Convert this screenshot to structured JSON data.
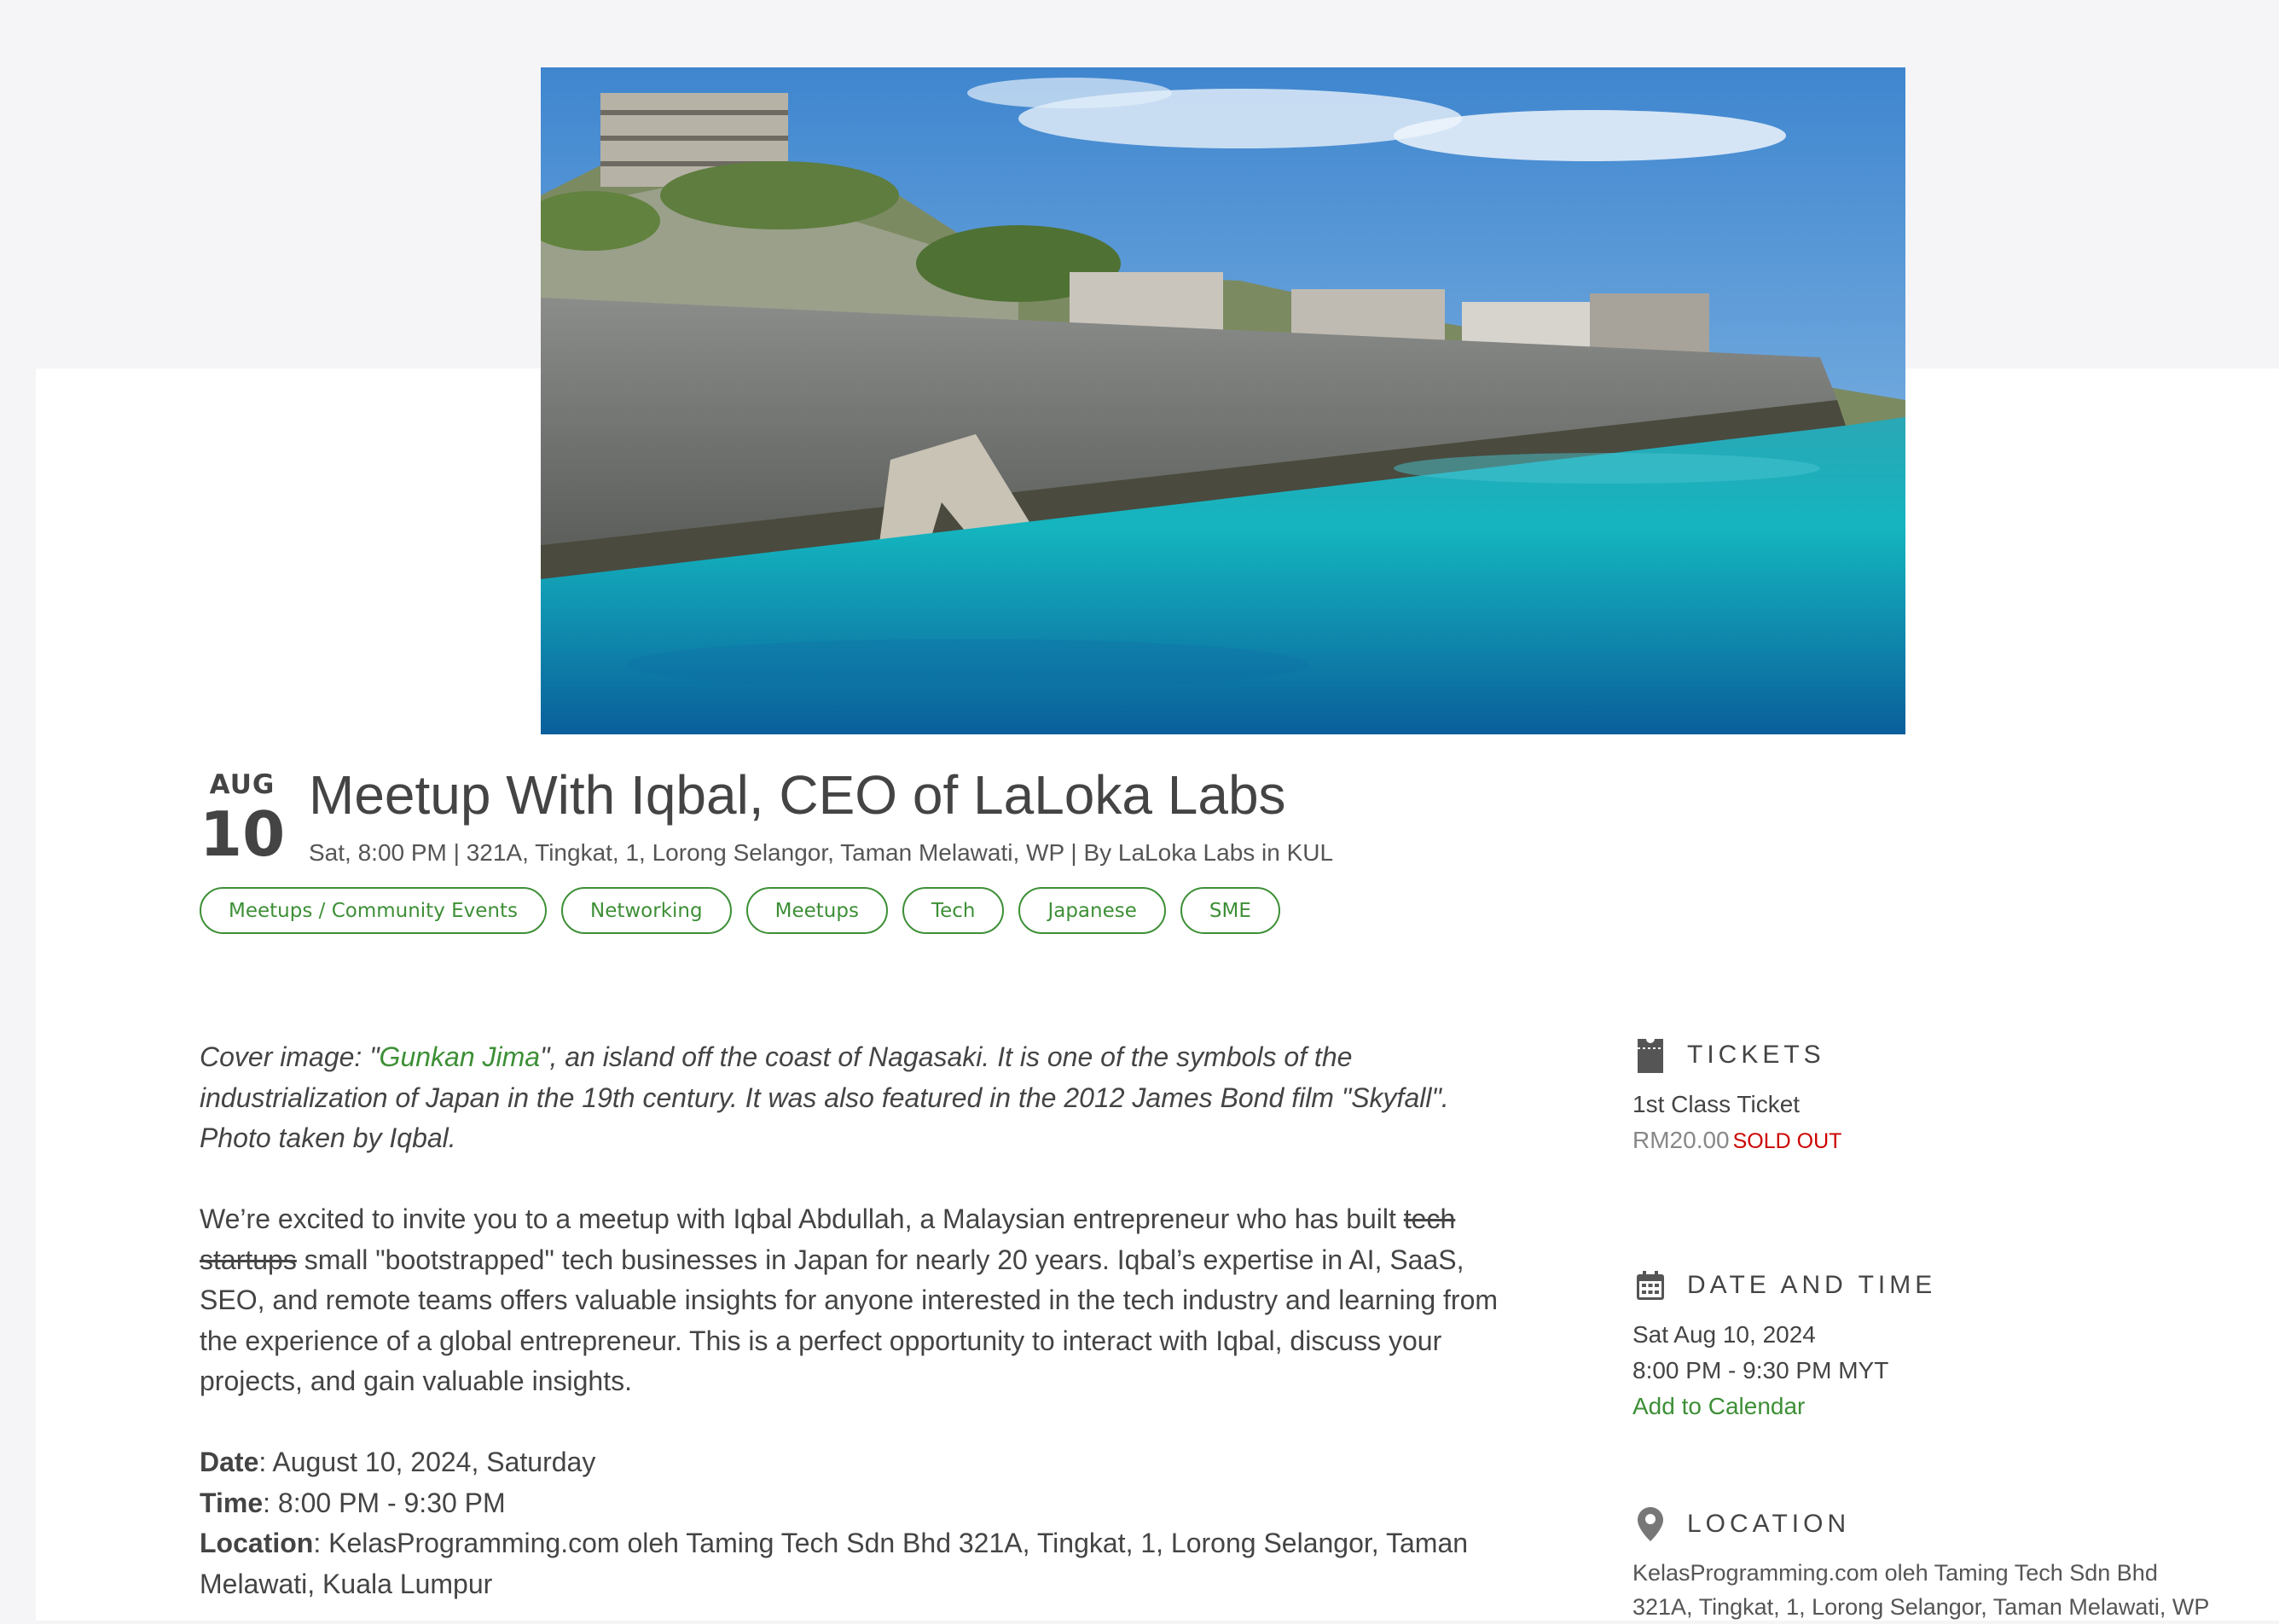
{
  "event": {
    "month": "AUG",
    "day": "10",
    "title": "Meetup With Iqbal, CEO of LaLoka Labs",
    "subline": "Sat, 8:00 PM | 321A, Tingkat, 1, Lorong Selangor, Taman Melawati, WP | By LaLoka Labs in KUL"
  },
  "tags": [
    "Meetups / Community Events",
    "Networking",
    "Meetups",
    "Tech",
    "Japanese",
    "SME"
  ],
  "description": {
    "cover_prefix": "Cover image: \"",
    "cover_link": "Gunkan Jima",
    "cover_suffix": "\", an island off the coast of Nagasaki. It is one of the symbols of the industrialization of Japan in the 19th century. It was also featured in the 2012 James Bond film \"Skyfall\". Photo taken by Iqbal.",
    "intro_before": "We’re excited to invite you to a meetup with Iqbal Abdullah, a Malaysian entrepreneur who has built ",
    "intro_strike": "tech startups",
    "intro_after": " small \"bootstrapped\" tech businesses in Japan for nearly 20 years. Iqbal’s expertise in AI, SaaS, SEO, and remote teams offers valuable insights for anyone interested in the tech industry and learning from the experience of a global entrepreneur. This is a perfect opportunity to interact with Iqbal, discuss your projects, and gain valuable insights.",
    "date_label": "Date",
    "date_value": ": August 10, 2024, Saturday",
    "time_label": "Time",
    "time_value": ": 8:00 PM - 9:30 PM",
    "location_label": "Location",
    "location_value": ": KelasProgramming.com oleh Taming Tech Sdn Bhd 321A, Tingkat, 1, Lorong Selangor, Taman Melawati, Kuala Lumpur"
  },
  "sidebar": {
    "tickets": {
      "heading": "TICKETS",
      "icon": "ticket-icon",
      "name": "1st Class Ticket",
      "price": "RM20.00",
      "status": "SOLD OUT"
    },
    "datetime": {
      "heading": "DATE AND TIME",
      "icon": "calendar-icon",
      "date": "Sat Aug 10, 2024",
      "time": "8:00 PM - 9:30 PM MYT",
      "add_calendar": "Add to Calendar"
    },
    "location": {
      "heading": "LOCATION",
      "icon": "map-pin-icon",
      "line1": "KelasProgramming.com oleh Taming Tech Sdn Bhd",
      "line2": "321A, Tingkat, 1, Lorong Selangor, Taman Melawati, WP"
    }
  },
  "colors": {
    "accent": "#3d8f36",
    "sold_out": "#cc0000",
    "text": "#444444",
    "page_bg": "#f5f5f7"
  }
}
